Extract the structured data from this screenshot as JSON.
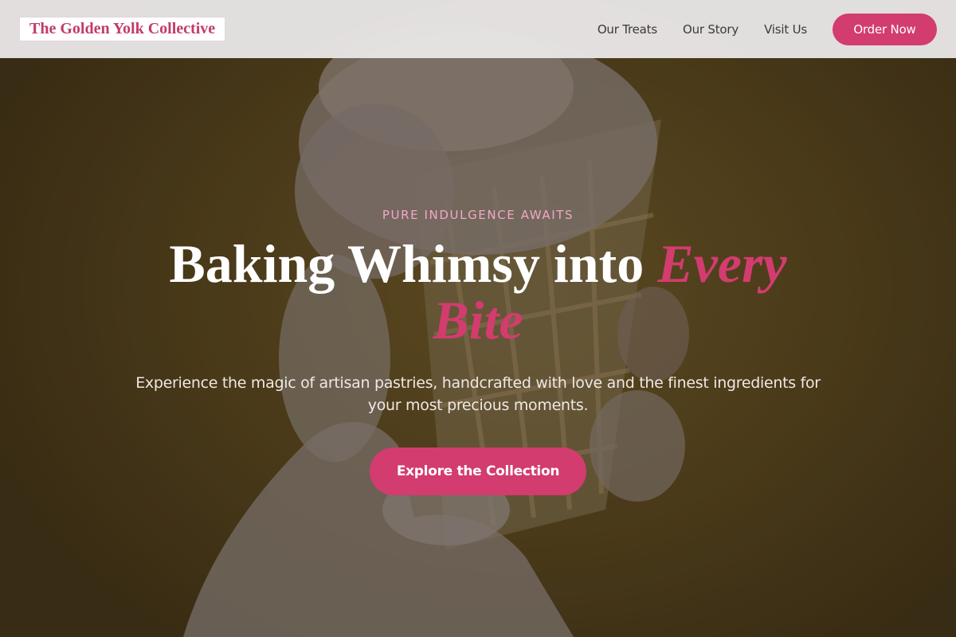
{
  "header": {
    "logo_text": "The Golden Yolk Collective",
    "nav": [
      {
        "label": "Our Treats"
      },
      {
        "label": "Our Story"
      },
      {
        "label": "Visit Us"
      }
    ],
    "order_button_label": "Order Now"
  },
  "hero": {
    "eyebrow": "PURE INDULGENCE AWAITS",
    "headline_main": "Baking Whimsy into ",
    "headline_accent": "Every Bite",
    "subtext": "Experience the magic of artisan pastries, handcrafted with love and the finest ingredients for your most precious moments.",
    "cta_label": "Explore the Collection",
    "background_image": "ice-cream-cone-in-hand-photo"
  },
  "colors": {
    "accent": "#d23c6e",
    "eyebrow": "#f2a7c7",
    "header_bg": "#e8e6e6",
    "hero_bg": "#54421d"
  }
}
